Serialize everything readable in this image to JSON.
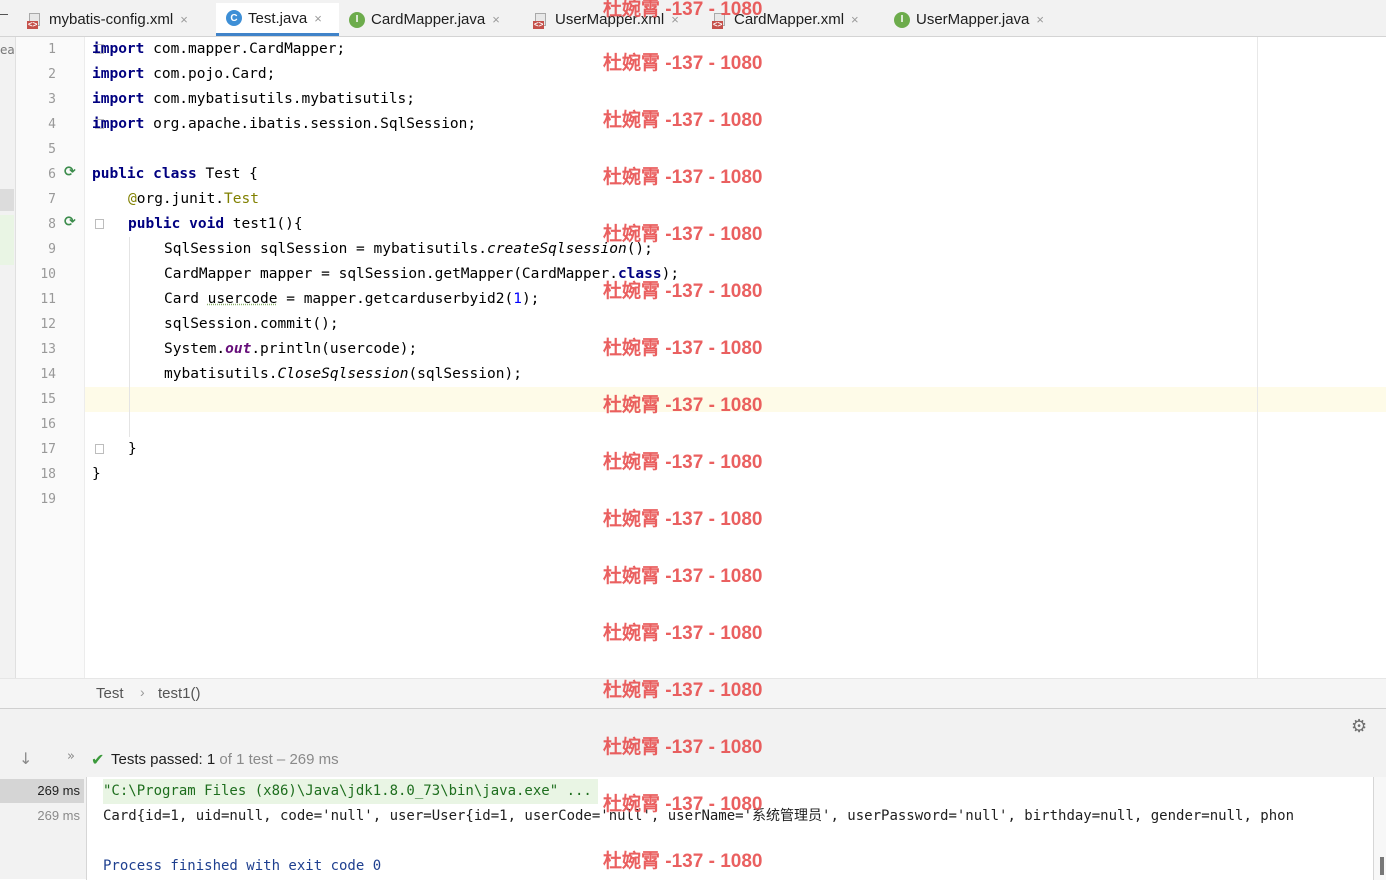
{
  "tabs": [
    {
      "label": "mybatis-config.xml",
      "icon": "xml-file-icon",
      "active": false
    },
    {
      "label": "Test.java",
      "icon": "class-file-icon",
      "active": true
    },
    {
      "label": "CardMapper.java",
      "icon": "interface-file-icon",
      "active": false
    },
    {
      "label": "UserMapper.xml",
      "icon": "xml-file-icon",
      "active": false
    },
    {
      "label": "CardMapper.xml",
      "icon": "xml-file-icon",
      "active": false
    },
    {
      "label": "UserMapper.java",
      "icon": "interface-file-icon",
      "active": false
    }
  ],
  "tab_close_glyph": "×",
  "left_strip_text": "ea",
  "line_numbers": [
    "1",
    "2",
    "3",
    "4",
    "5",
    "6",
    "7",
    "8",
    "9",
    "10",
    "11",
    "12",
    "13",
    "14",
    "15",
    "16",
    "17",
    "18",
    "19"
  ],
  "current_line": 15,
  "code": {
    "l1_kw": "import",
    "l1": " com.mapper.CardMapper;",
    "l2_kw": "import",
    "l2": " com.pojo.Card;",
    "l3_kw": "import",
    "l3": " com.mybatisutils.mybatisutils;",
    "l4_kw": "import",
    "l4": " org.apache.ibatis.session.SqlSession;",
    "l6_kw1": "public",
    "l6_kw2": "class",
    "l6": " Test {",
    "l7_ann": "@",
    "l7_a": "org.junit.",
    "l7_b": "Test",
    "l8_kw1": "public",
    "l8_kw2": "void",
    "l8": " test1(){",
    "l9_a": "SqlSession sqlSession = mybatisutils.",
    "l9_i": "createSqlsession",
    "l9_b": "();",
    "l10_a": "CardMapper mapper = sqlSession.getMapper(CardMapper.",
    "l10_kw": "class",
    "l10_b": ");",
    "l11_a": "Card ",
    "l11_u": "usercode",
    "l11_b": " = mapper.getcarduserbyid2(",
    "l11_n": "1",
    "l11_c": ");",
    "l12": "sqlSession.commit();",
    "l13_a": "System.",
    "l13_s": "out",
    "l13_b": ".println(usercode);",
    "l14_a": "mybatisutils.",
    "l14_i": "CloseSqlsession",
    "l14_b": "(sqlSession);",
    "l17": "}",
    "l18": "}"
  },
  "breadcrumb": {
    "first": "Test",
    "separator": "›",
    "second": "test1()"
  },
  "run": {
    "status_prefix": "Tests passed: ",
    "status_count": "1",
    "status_rest": " of 1 test – 269 ms",
    "tree": [
      {
        "label": "269 ms",
        "selected": true
      },
      {
        "label": "269 ms",
        "selected": false
      }
    ],
    "console": [
      "\"C:\\Program Files (x86)\\Java\\jdk1.8.0_73\\bin\\java.exe\" ...",
      "Card{id=1, uid=null, code='null', user=User{id=1, userCode='null', userName='系统管理员', userPassword='null', birthday=null, gender=null, phon",
      "",
      "Process finished with exit code 0"
    ]
  },
  "icons": {
    "settings": "gear-icon",
    "rerun": "down-arrow-icon",
    "expand": "double-chevron-icon",
    "passed": "check-icon",
    "gutter_run": "run-test-icon"
  },
  "watermark": "杜婉霄 -137 - 1080",
  "colors": {
    "keyword": "#000080",
    "annotation": "#808000",
    "caret_line": "#fefbe8",
    "active_tab_underline": "#4083c9",
    "watermark": "#e84f4f",
    "passed": "#3c9a3c"
  }
}
